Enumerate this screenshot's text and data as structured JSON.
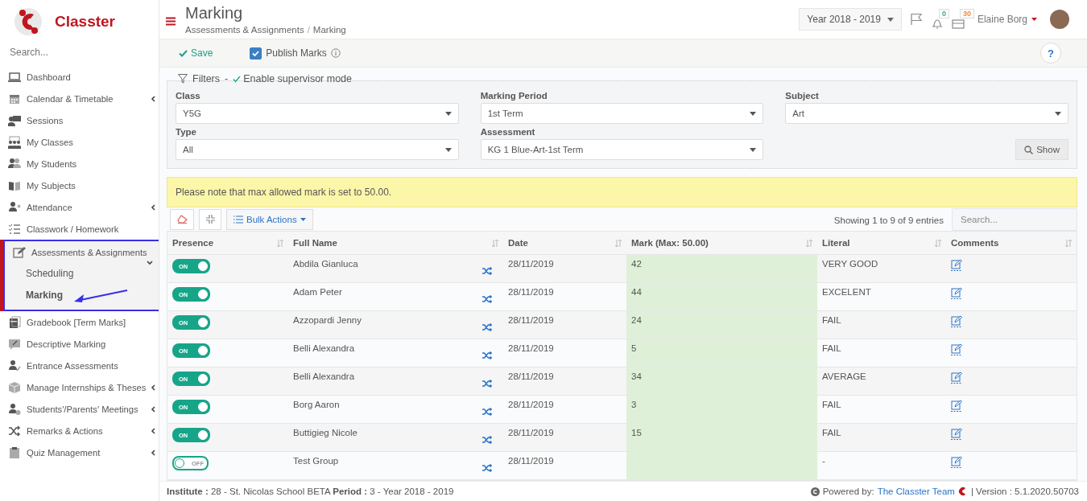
{
  "brand": {
    "logo_text": "Classter"
  },
  "sidebar": {
    "search_placeholder": "Search...",
    "items": [
      {
        "label": "Dashboard",
        "expandable": false,
        "expanded": false,
        "selected": false
      },
      {
        "label": "Calendar & Timetable",
        "expandable": true,
        "expanded": false,
        "selected": false
      },
      {
        "label": "Sessions",
        "expandable": false,
        "expanded": false,
        "selected": false
      },
      {
        "label": "My Classes",
        "expandable": false,
        "expanded": false,
        "selected": false
      },
      {
        "label": "My Students",
        "expandable": false,
        "expanded": false,
        "selected": false
      },
      {
        "label": "My Subjects",
        "expandable": false,
        "expanded": false,
        "selected": false
      },
      {
        "label": "Attendance",
        "expandable": true,
        "expanded": false,
        "selected": false
      },
      {
        "label": "Classwork / Homework",
        "expandable": false,
        "expanded": false,
        "selected": false
      },
      {
        "label": "Assessments & Assignments",
        "expandable": true,
        "expanded": true,
        "selected": true,
        "children": [
          {
            "label": "Scheduling",
            "selected": false
          },
          {
            "label": "Marking",
            "selected": true
          }
        ]
      },
      {
        "label": "Gradebook [Term Marks]",
        "expandable": false,
        "expanded": false,
        "selected": false
      },
      {
        "label": "Descriptive Marking",
        "expandable": false,
        "expanded": false,
        "selected": false
      },
      {
        "label": "Entrance Assessments",
        "expandable": false,
        "expanded": false,
        "selected": false
      },
      {
        "label": "Manage Internships & Theses",
        "expandable": true,
        "expanded": false,
        "selected": false
      },
      {
        "label": "Students'/Parents' Meetings",
        "expandable": true,
        "expanded": false,
        "selected": false
      },
      {
        "label": "Remarks & Actions",
        "expandable": true,
        "expanded": false,
        "selected": false
      },
      {
        "label": "Quiz Management",
        "expandable": true,
        "expanded": false,
        "selected": false
      }
    ]
  },
  "header": {
    "title": "Marking",
    "breadcrumb": [
      "Assessments & Assignments",
      "Marking"
    ],
    "breadcrumb_separator": "/",
    "year": "Year 2018 - 2019",
    "notifications": "0",
    "messages": "30",
    "user": "Elaine Borg"
  },
  "toolbar": {
    "save": "Save",
    "publish": {
      "label": "Publish Marks",
      "checked": true
    },
    "help": "?"
  },
  "filters": {
    "legend": "Filters",
    "separator": "-",
    "supervisor": "Enable supervisor mode",
    "fields": [
      {
        "label": "Class",
        "value": "Y5G"
      },
      {
        "label": "Marking Period",
        "value": "1st Term"
      },
      {
        "label": "Subject",
        "value": "Art"
      },
      {
        "label": "Type",
        "value": "All"
      },
      {
        "label": "Assessment",
        "value": "KG 1 Blue-Art-1st Term"
      }
    ],
    "show": "Show"
  },
  "notice": "Please note that max allowed mark is set to 50.00.",
  "table": {
    "bulk_actions": "Bulk Actions",
    "info": "Showing 1 to 9 of 9 entries",
    "search_placeholder": "Search...",
    "columns": [
      "Presence",
      "Full Name",
      "Date",
      "Mark (Max: 50.00)",
      "Literal",
      "Comments"
    ],
    "rows": [
      {
        "present": true,
        "toggle_label": "ON",
        "name": "Abdila Gianluca",
        "date": "28/11/2019",
        "mark": "42",
        "literal": "VERY GOOD"
      },
      {
        "present": true,
        "toggle_label": "ON",
        "name": "Adam Peter",
        "date": "28/11/2019",
        "mark": "44",
        "literal": "EXCELENT"
      },
      {
        "present": true,
        "toggle_label": "ON",
        "name": "Azzopardi Jenny",
        "date": "28/11/2019",
        "mark": "24",
        "literal": "FAIL"
      },
      {
        "present": true,
        "toggle_label": "ON",
        "name": "Belli Alexandra",
        "date": "28/11/2019",
        "mark": "5",
        "literal": "FAIL"
      },
      {
        "present": true,
        "toggle_label": "ON",
        "name": "Belli Alexandra",
        "date": "28/11/2019",
        "mark": "34",
        "literal": "AVERAGE"
      },
      {
        "present": true,
        "toggle_label": "ON",
        "name": "Borg Aaron",
        "date": "28/11/2019",
        "mark": "3",
        "literal": "FAIL"
      },
      {
        "present": true,
        "toggle_label": "ON",
        "name": "Buttigieg Nicole",
        "date": "28/11/2019",
        "mark": "15",
        "literal": "FAIL"
      },
      {
        "present": false,
        "toggle_label": "OFF",
        "name": "Test Group",
        "date": "28/11/2019",
        "literal": "-"
      }
    ]
  },
  "footer": {
    "info": "**Institute :** 28 - St. Nicolas School BETA **Period :** 3 - Year 2018 - 2019",
    "powered": "Powered by:",
    "team": "The Classter Team",
    "version": "| Version : 5.1.2020.50703"
  }
}
